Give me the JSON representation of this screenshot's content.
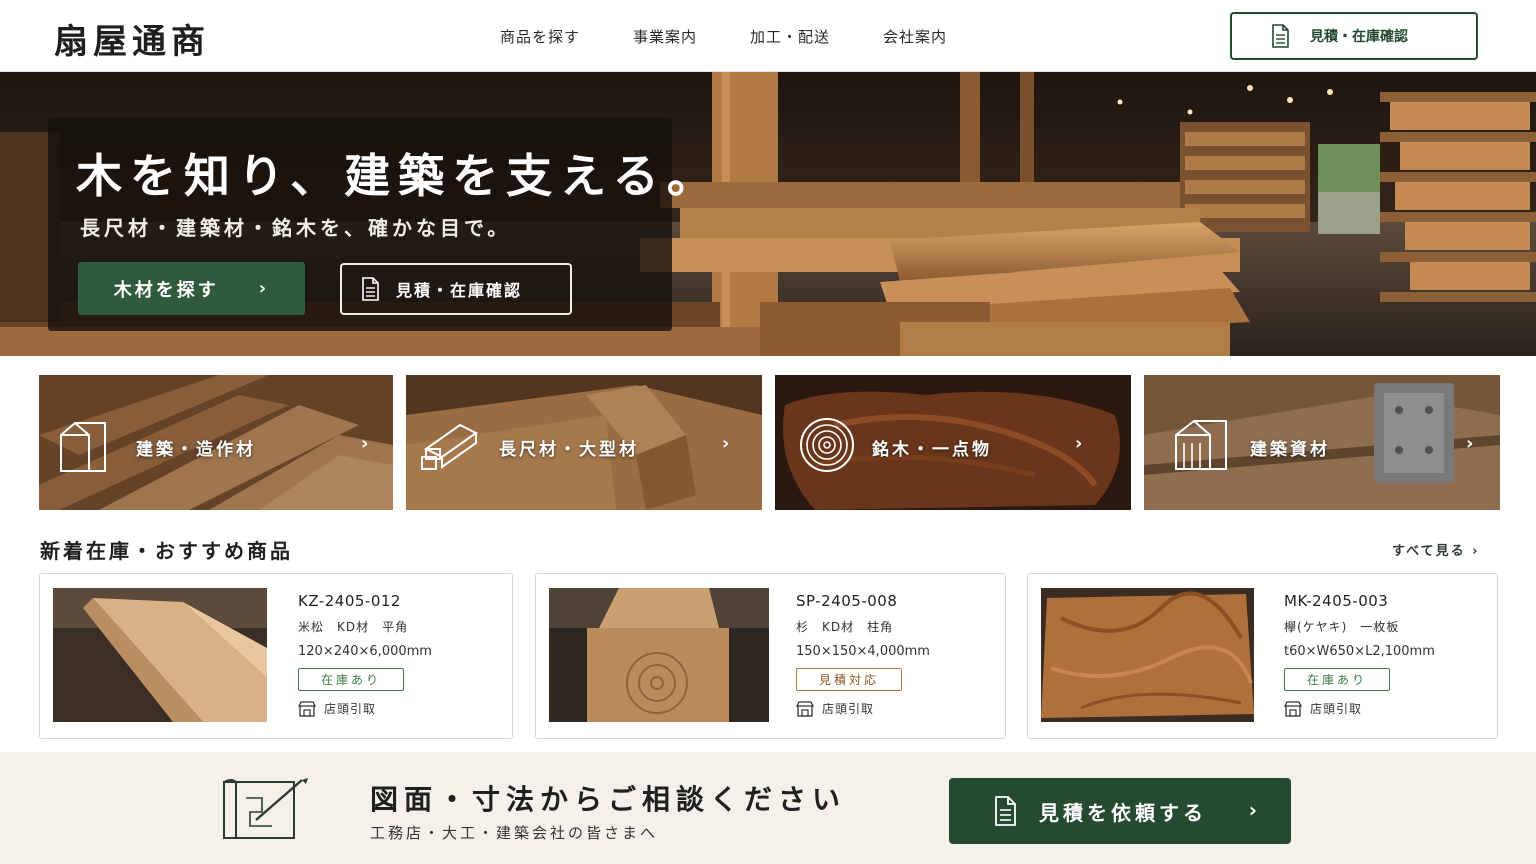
{
  "header": {
    "logo": "扇屋通商",
    "nav": [
      "商品を探す",
      "事業案内",
      "加工・配送",
      "会社案内"
    ],
    "cta_label": "見積・在庫確認"
  },
  "hero": {
    "title": "木を知り、建築を支える。",
    "subtitle": "長尺材・建築材・銘木を、確かな目で。",
    "primary_button": "木材を探す",
    "secondary_button": "見積・在庫確認"
  },
  "categories": [
    {
      "label": "建築・造作材",
      "icon": "house-outline-icon"
    },
    {
      "label": "長尺材・大型材",
      "icon": "timber-stack-icon"
    },
    {
      "label": "銘木・一点物",
      "icon": "tree-rings-icon"
    },
    {
      "label": "建築資材",
      "icon": "building-icon"
    }
  ],
  "new_arrivals": {
    "title": "新着在庫・おすすめ商品",
    "see_all": "すべて見る",
    "items": [
      {
        "code": "KZ-2405-012",
        "spec": "米松　KD材　平角",
        "dimensions": "120×240×6,000mm",
        "badge": "在庫あり",
        "pickup": "店頭引取"
      },
      {
        "code": "SP-2405-008",
        "spec": "杉　KD材　柱角",
        "dimensions": "150×150×4,000mm",
        "badge": "見積対応",
        "pickup": "店頭引取"
      },
      {
        "code": "MK-2405-003",
        "spec": "欅(ケヤキ)　一枚板",
        "dimensions": "t60×W650×L2,100mm",
        "badge": "在庫あり",
        "pickup": "店頭引取"
      }
    ]
  },
  "consult": {
    "title": "図面・寸法からご相談ください",
    "subtitle": "工務店・大工・建築会社の皆さまへ",
    "button": "見積を依頼する"
  },
  "colors": {
    "brand_green": "#244a30",
    "stock_green": "#3f7a4c",
    "quote_brown": "#8a5522"
  }
}
